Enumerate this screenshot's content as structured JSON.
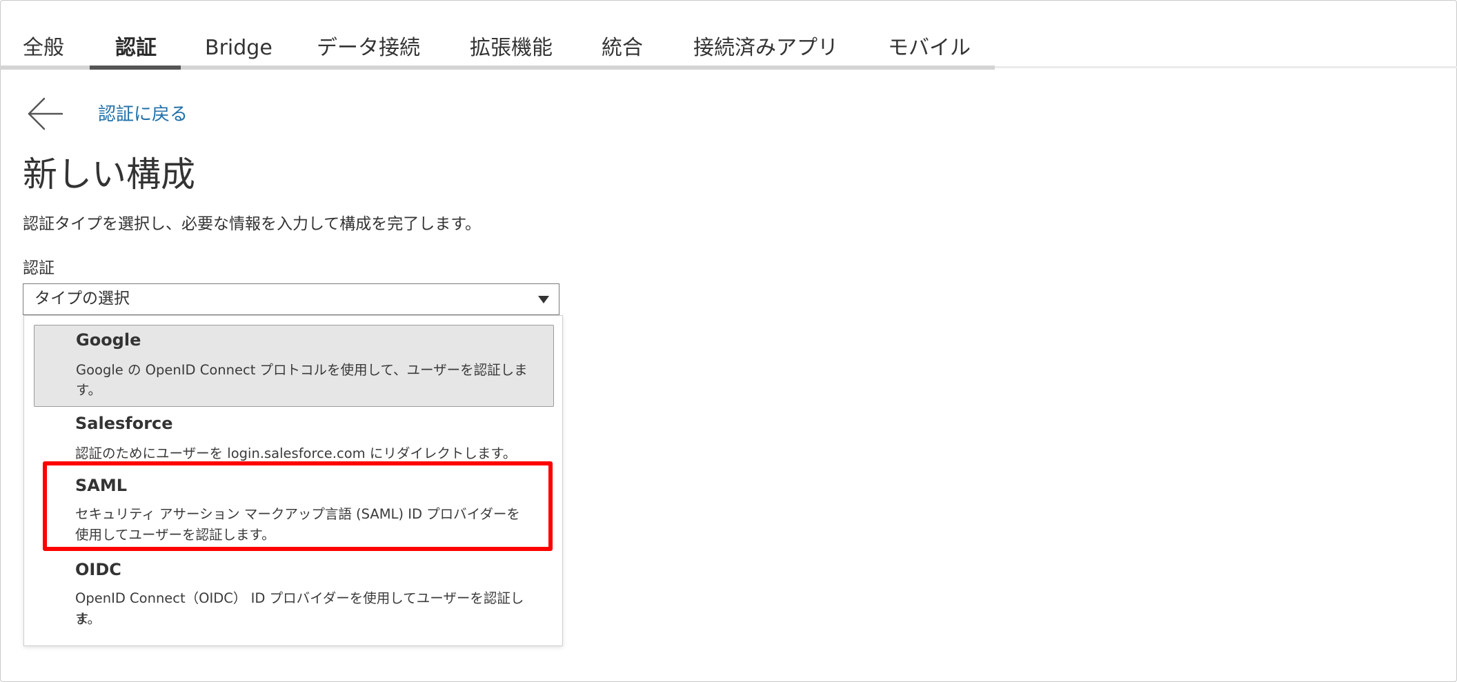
{
  "tabs": [
    {
      "label": "全般"
    },
    {
      "label": "認証"
    },
    {
      "label": "Bridge"
    },
    {
      "label": "データ接続"
    },
    {
      "label": "拡張機能"
    },
    {
      "label": "統合"
    },
    {
      "label": "接続済みアプリ"
    },
    {
      "label": "モバイル"
    }
  ],
  "active_tab": "認証",
  "back": {
    "icon": "arrow-left-icon",
    "label": "認証に戻る"
  },
  "page": {
    "title": "新しい構成",
    "description": "認証タイプを選択し、必要な情報を入力して構成を完了します。"
  },
  "auth_field": {
    "label": "認証",
    "selected_value": "タイプの選択",
    "caret_icon": "caret-down-icon"
  },
  "options": [
    {
      "title": "Google",
      "desc_line1": "Google の OpenID Connect プロトコルを使用して、ユーザーを認証しま",
      "desc_line2": "す。"
    },
    {
      "title": "Salesforce",
      "desc_line1": "認証のためにユーザーを login.salesforce.com にリダイレクトします。",
      "desc_line2": ""
    },
    {
      "title": "SAML",
      "desc_line1": "セキュリティ アサーション マークアップ言語 (SAML) ID プロバイダーを",
      "desc_line2": "使用してユーザーを認証します。"
    },
    {
      "title": "OIDC",
      "desc_line1": "OpenID Connect（OIDC） ID プロバイダーを使用してユーザーを認証しま",
      "desc_line2": "す。"
    }
  ],
  "colors": {
    "link": "#1f6fa8",
    "highlight": "#ff0000",
    "selected_option_bg": "#e6e6e6"
  }
}
